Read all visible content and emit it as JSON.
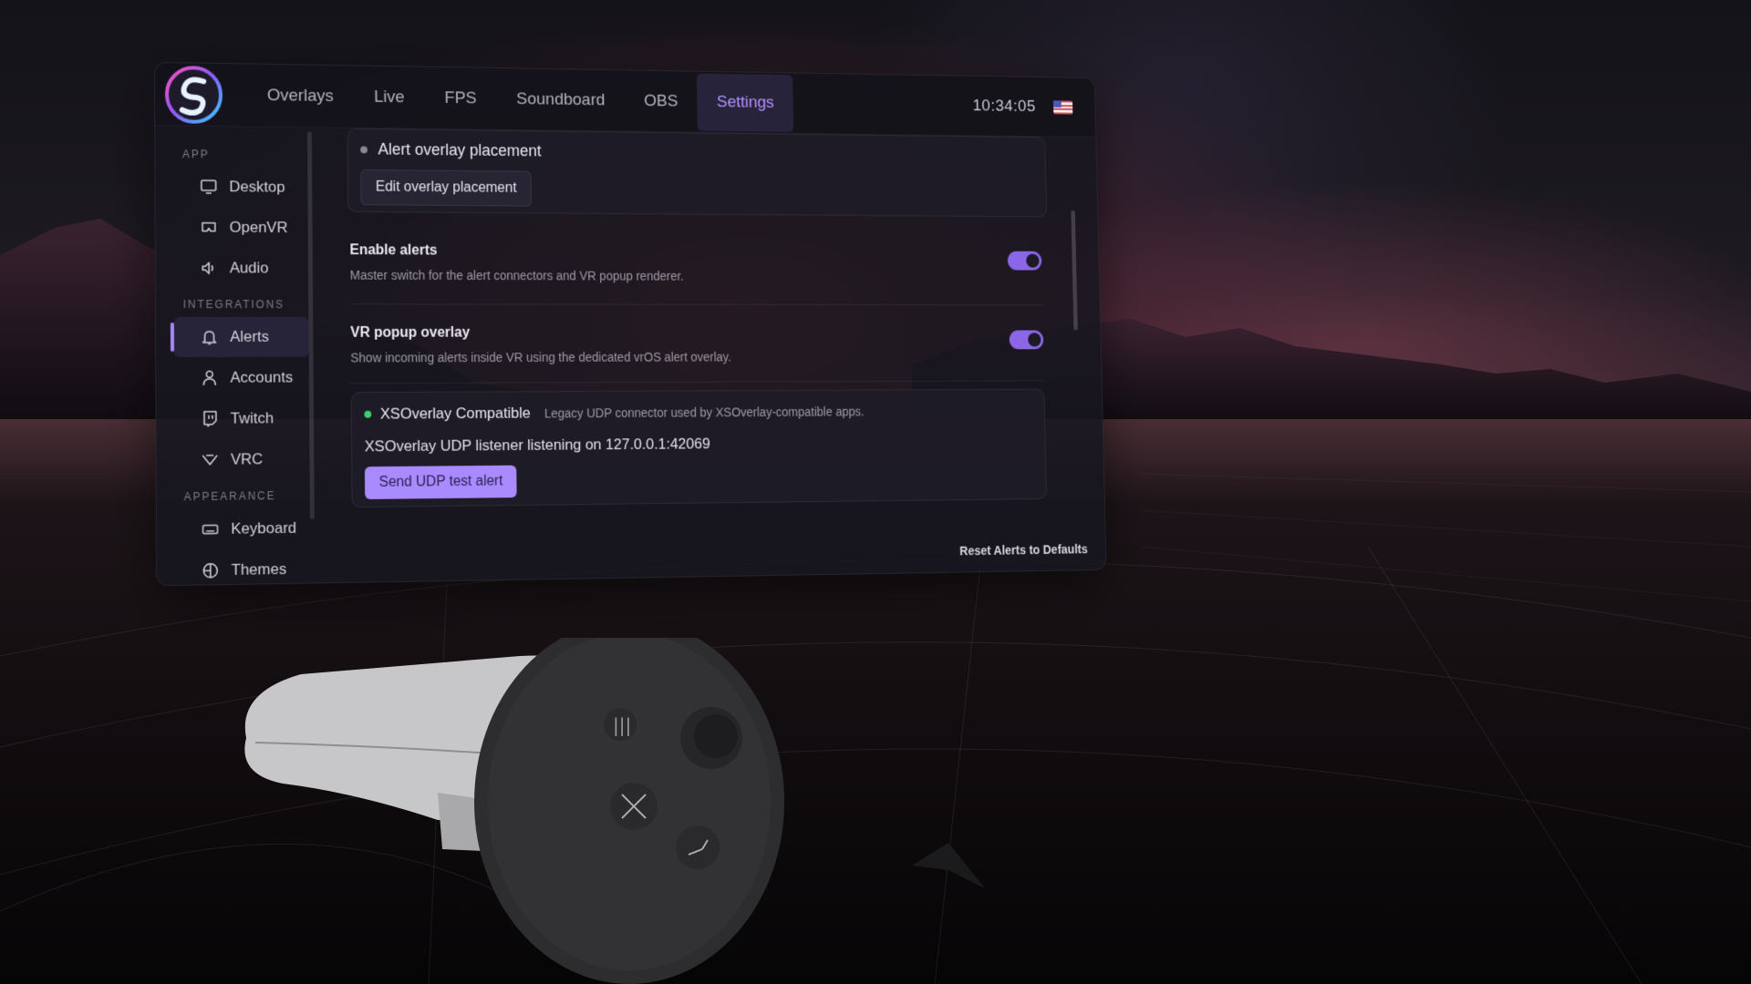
{
  "header": {
    "tabs": [
      {
        "label": "Overlays"
      },
      {
        "label": "Live"
      },
      {
        "label": "FPS"
      },
      {
        "label": "Soundboard"
      },
      {
        "label": "OBS"
      },
      {
        "label": "Settings",
        "active": true
      }
    ],
    "clock": "10:34:05",
    "locale_flag": "us-flag-icon"
  },
  "sidebar": {
    "sections": [
      {
        "label": "APP",
        "items": [
          {
            "label": "Desktop",
            "icon": "monitor-icon"
          },
          {
            "label": "OpenVR",
            "icon": "vr-headset-icon"
          },
          {
            "label": "Audio",
            "icon": "speaker-icon"
          }
        ]
      },
      {
        "label": "INTEGRATIONS",
        "items": [
          {
            "label": "Alerts",
            "icon": "bell-icon",
            "active": true
          },
          {
            "label": "Accounts",
            "icon": "user-icon"
          },
          {
            "label": "Twitch",
            "icon": "twitch-icon"
          },
          {
            "label": "VRC",
            "icon": "vrc-icon"
          }
        ]
      },
      {
        "label": "APPEARANCE",
        "items": [
          {
            "label": "Keyboard",
            "icon": "keyboard-icon"
          },
          {
            "label": "Themes",
            "icon": "palette-icon"
          }
        ]
      }
    ]
  },
  "content": {
    "placement": {
      "title": "Alert overlay placement",
      "button": "Edit overlay placement"
    },
    "enable_alerts": {
      "title": "Enable alerts",
      "description": "Master switch for the alert connectors and VR popup renderer.",
      "enabled": true
    },
    "vr_popup": {
      "title": "VR popup overlay",
      "description": "Show incoming alerts inside VR using the dedicated vrOS alert overlay.",
      "enabled": true
    },
    "xsoverlay": {
      "title": "XSOverlay Compatible",
      "description": "Legacy UDP connector used by XSOverlay-compatible apps.",
      "status": "XSOverlay UDP listener listening on 127.0.0.1:42069",
      "button": "Send UDP test alert"
    },
    "reset": "Reset Alerts to Defaults"
  },
  "colors": {
    "accent": "#a98bff",
    "toggle_on": "#8b67e8",
    "status_ok": "#3ccf6e"
  }
}
